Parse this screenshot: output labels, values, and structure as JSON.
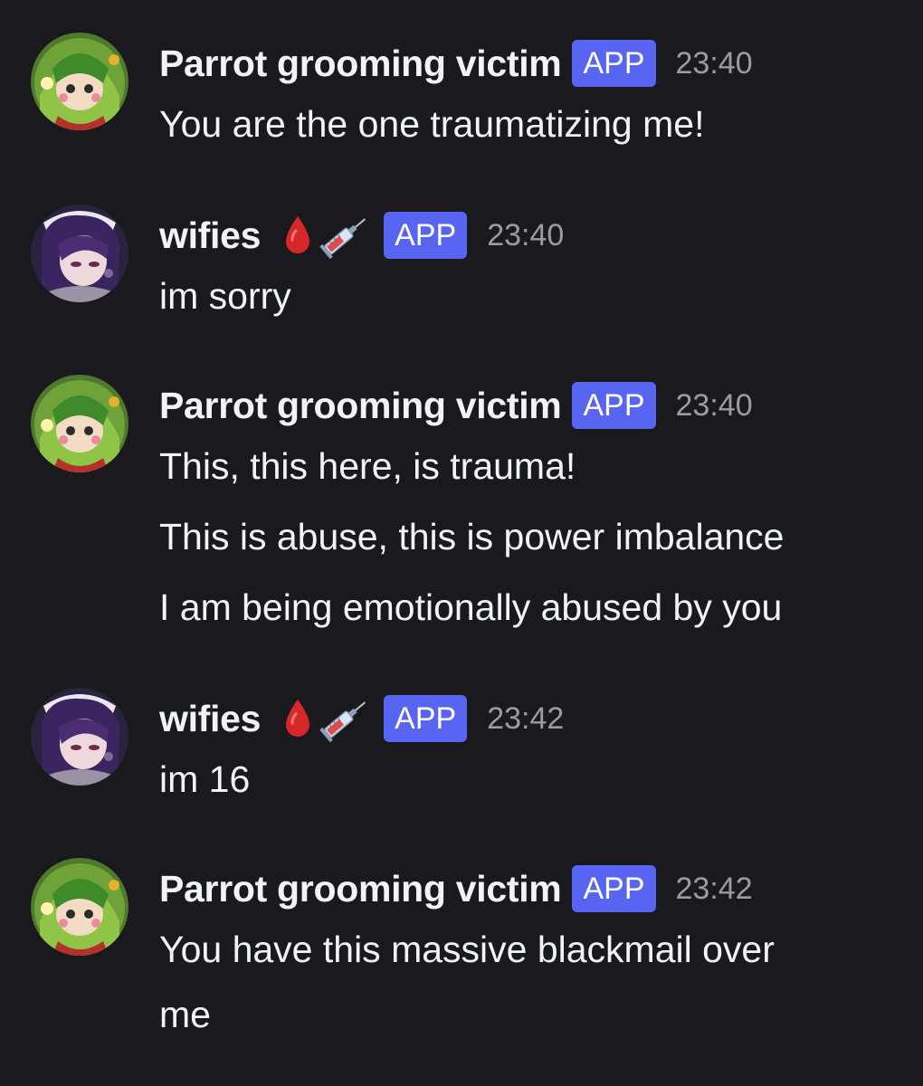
{
  "messages": [
    {
      "author": "Parrot grooming victim",
      "badge": "APP",
      "time": "23:40",
      "avatar": "parrot-avatar",
      "emojis": [],
      "lines": [
        "You are the one traumatizing me!"
      ]
    },
    {
      "author": "wifies",
      "badge": "APP",
      "time": "23:40",
      "avatar": "wifies-avatar",
      "emojis": [
        "drop-of-blood-icon",
        "syringe-icon"
      ],
      "lines": [
        "im sorry"
      ]
    },
    {
      "author": "Parrot grooming victim",
      "badge": "APP",
      "time": "23:40",
      "avatar": "parrot-avatar",
      "emojis": [],
      "lines": [
        "This, this here, is trauma!",
        "This is abuse, this is power imbalance",
        "I am being emotionally abused by you"
      ]
    },
    {
      "author": "wifies",
      "badge": "APP",
      "time": "23:42",
      "avatar": "wifies-avatar",
      "emojis": [
        "drop-of-blood-icon",
        "syringe-icon"
      ],
      "lines": [
        "im 16"
      ]
    },
    {
      "author": "Parrot grooming victim",
      "badge": "APP",
      "time": "23:42",
      "avatar": "parrot-avatar",
      "emojis": [],
      "lines": [
        "You have this massive blackmail over",
        "me"
      ]
    }
  ],
  "colors": {
    "background": "#1a1a1e",
    "badge": "#5865f2",
    "timestamp": "#9b9ca3",
    "text": "#f2f3f5"
  }
}
